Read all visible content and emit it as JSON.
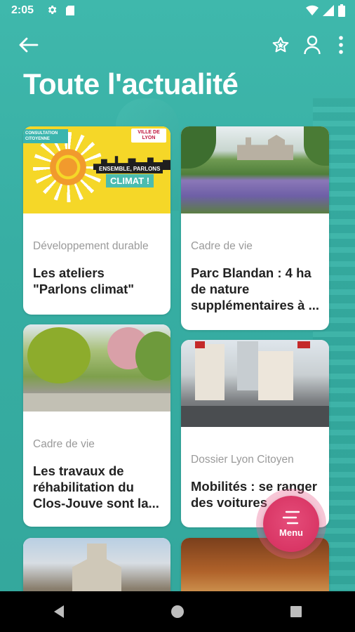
{
  "status_bar": {
    "time": "2:05"
  },
  "header": {
    "title": "Toute l'actualité"
  },
  "cards": [
    {
      "category": "Développement durable",
      "title": "Les ateliers \"Parlons climat\"",
      "image": {
        "badge_1": "CONSULTATION CITOYENNE",
        "badge_2": "VILLE DE LYON",
        "headline_1": "ENSEMBLE, PARLONS",
        "headline_2": "CLIMAT !"
      }
    },
    {
      "category": "Cadre de vie",
      "title": "Parc Blandan : 4 ha de nature supplémentaires à ..."
    },
    {
      "category": "Cadre de vie",
      "title": "Les travaux de réhabilitation du Clos-Jouve sont la..."
    },
    {
      "category": "Dossier Lyon Citoyen",
      "title": "Mobilités : se ranger des voitures"
    }
  ],
  "fab": {
    "label": "Menu"
  }
}
